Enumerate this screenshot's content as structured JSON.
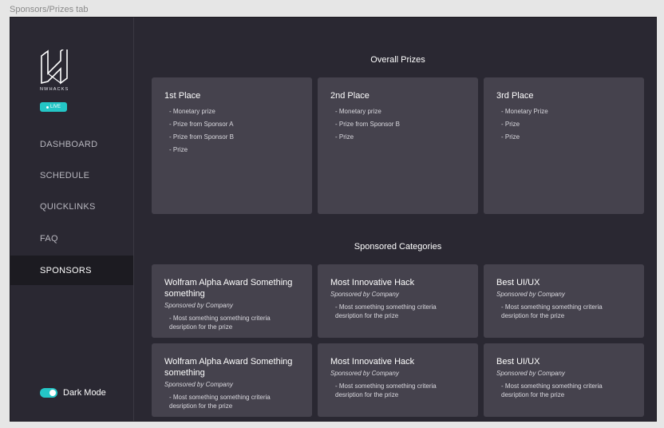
{
  "frame_label": "Sponsors/Prizes tab",
  "sidebar": {
    "logo_text": "NWHACKS",
    "live_label": "LIVE",
    "items": [
      {
        "label": "DASHBOARD",
        "active": false
      },
      {
        "label": "SCHEDULE",
        "active": false
      },
      {
        "label": "QUICKLINKS",
        "active": false
      },
      {
        "label": "FAQ",
        "active": false
      },
      {
        "label": "SPONSORS",
        "active": true
      }
    ],
    "dark_mode_label": "Dark Mode",
    "dark_mode_on": true
  },
  "colors": {
    "accent": "#24c6c6",
    "card": "#45424d",
    "background": "#2a2832",
    "active_nav": "#1c1b21"
  },
  "overall_prizes": {
    "title": "Overall Prizes",
    "cards": [
      {
        "title": "1st Place",
        "items": [
          "- Monetary prize",
          "- Prize from Sponsor A",
          "- Prize from Sponsor B",
          "- Prize"
        ]
      },
      {
        "title": "2nd Place",
        "items": [
          "- Monetary prize",
          "- Prize from Sponsor B",
          "- Prize"
        ]
      },
      {
        "title": "3rd Place",
        "items": [
          "- Monetary Prize",
          "- Prize",
          "- Prize"
        ]
      }
    ]
  },
  "sponsored_categories": {
    "title": "Sponsored Categories",
    "cards": [
      {
        "title": "Wolfram Alpha Award Something something",
        "sponsor": "Sponsored by Company",
        "description": "- Most something something criteria desription for the prize"
      },
      {
        "title": "Most Innovative Hack",
        "sponsor": "Sponsored by Company",
        "description": "- Most something something criteria desription for the prize"
      },
      {
        "title": "Best UI/UX",
        "sponsor": "Sponsored by Company",
        "description": "- Most something something criteria desription for the prize"
      },
      {
        "title": "Wolfram Alpha Award Something something",
        "sponsor": "Sponsored by Company",
        "description": "- Most something something criteria desription for the prize"
      },
      {
        "title": "Most Innovative Hack",
        "sponsor": "Sponsored by Company",
        "description": "- Most something something criteria desription for the prize"
      },
      {
        "title": "Best UI/UX",
        "sponsor": "Sponsored by Company",
        "description": "- Most something something criteria desription for the prize"
      }
    ]
  }
}
